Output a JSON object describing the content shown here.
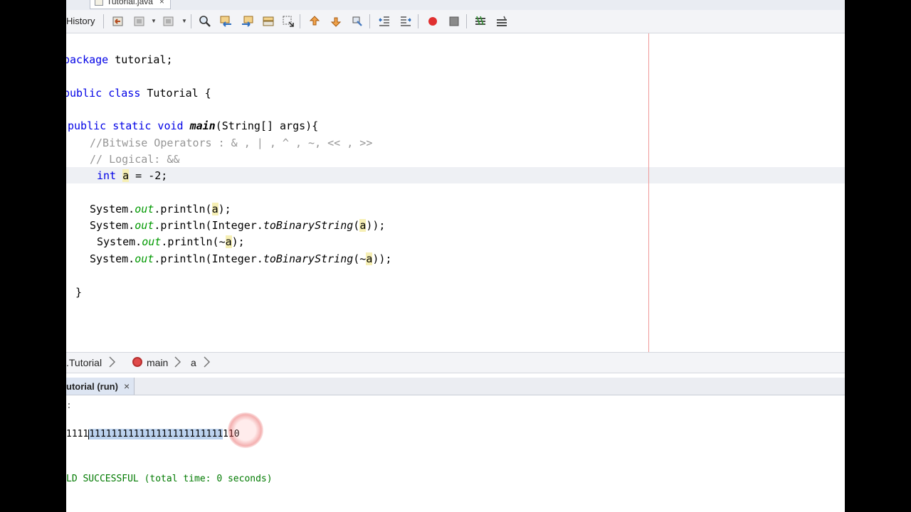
{
  "tab": {
    "filename": "Tutorial.java",
    "close": "×"
  },
  "toolbar": {
    "history_label": "History",
    "icons": [
      "back-icon",
      "recent-edits-icon",
      "forward-icon",
      "find-icon",
      "find-previous-icon",
      "find-next-icon",
      "toggle-highlight-icon",
      "toggle-rectangular-icon",
      "previous-bookmark-icon",
      "next-bookmark-icon",
      "toggle-bookmark-icon",
      "shift-left-icon",
      "shift-right-icon",
      "start-macro-icon",
      "stop-macro-icon",
      "comment-icon",
      "uncomment-icon"
    ]
  },
  "editor": {
    "line1": {
      "kw": "package",
      "rest": " tutorial;"
    },
    "line2": {
      "kw": "public class",
      "rest": " Tutorial {"
    },
    "line3": {
      "kw": "public static void",
      "sp": " ",
      "method": "main",
      "rest": "(String[] args){"
    },
    "line4": "//Bitwise Operators : & , | , ^ , ~, << , >>",
    "line5": "// Logical: &&",
    "line6": {
      "kw": "int",
      "sp": " ",
      "var": "a",
      "rest": " = -2;"
    },
    "line7": {
      "a": "System.",
      "b": "out",
      "c": ".println(",
      "d": "a",
      "e": ");"
    },
    "line8": {
      "a": "System.",
      "b": "out",
      "c": ".println(Integer.",
      "d": "toBinaryString",
      "e": "(",
      "f": "a",
      "g": "));"
    },
    "line9": {
      "a": "System.",
      "b": "out",
      "c": ".println(~",
      "d": "a",
      "e": ");"
    },
    "line10": {
      "a": "System.",
      "b": "out",
      "c": ".println(Integer.",
      "d": "toBinaryString",
      "e": "(~",
      "f": "a",
      "g": "));"
    },
    "line11": "}"
  },
  "breadcrumb": {
    "class_item": ".Tutorial",
    "method_item": "main",
    "variable_item": "a"
  },
  "output": {
    "tab_label": "utorial (run)",
    "tab_close": "×",
    "line1": ":",
    "binary_prefix": "1111",
    "binary_selected": "111111111111111111111111",
    "binary_rest": "110",
    "build_status": "LD SUCCESSFUL (total time: 0 seconds)"
  }
}
